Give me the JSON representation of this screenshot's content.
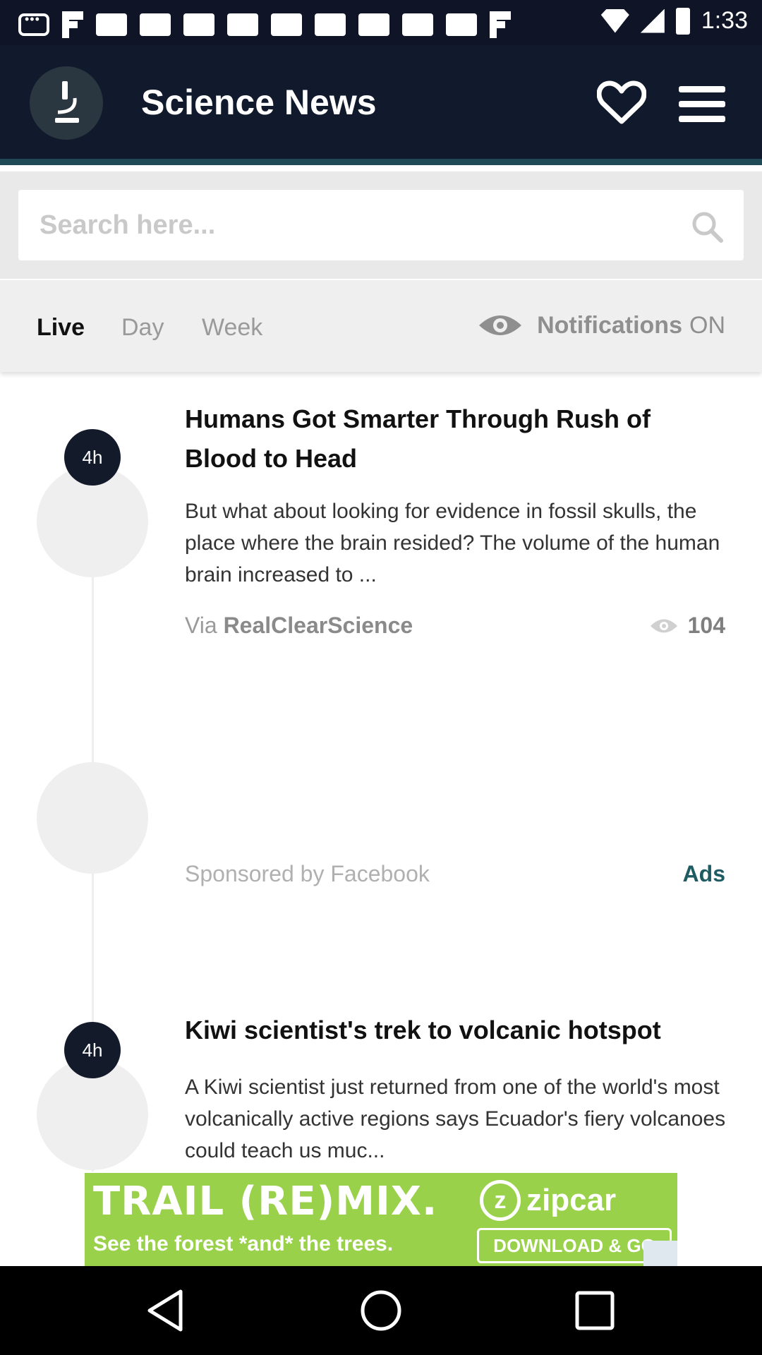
{
  "status_bar": {
    "time": "1:33"
  },
  "app": {
    "title": "Science News"
  },
  "search": {
    "placeholder": "Search here..."
  },
  "filters": {
    "tabs": [
      {
        "label": "Live",
        "active": true
      },
      {
        "label": "Day",
        "active": false
      },
      {
        "label": "Week",
        "active": false
      }
    ],
    "notifications_label": "Notifications",
    "notifications_state": "ON"
  },
  "feed": {
    "articles": [
      {
        "age": "4h",
        "title": "Humans Got Smarter Through Rush of Blood to Head",
        "body": "But what about looking for evidence in fossil skulls, the place where the brain resided? The volume of the human brain increased to ...",
        "via_prefix": "Via",
        "source": "RealClearScience",
        "views": "104"
      },
      {
        "age": "4h",
        "title": "Kiwi scientist's trek to volcanic hotspot",
        "body": "A Kiwi scientist just returned from one of the world's most volcanically active regions says Ecuador's fiery volcanoes could teach us muc..."
      }
    ],
    "sponsored": {
      "label": "Sponsored by Facebook",
      "ads_label": "Ads"
    }
  },
  "ad_banner": {
    "headline": "TRAIL (RE)MIX.",
    "subline": "See the forest *and* the trees.",
    "brand": "zipcar",
    "cta": "DOWNLOAD & GO"
  },
  "colors": {
    "app_bar": "#111a2c",
    "accent_teal": "#1f5b63",
    "ad_green": "#9ad14a"
  }
}
